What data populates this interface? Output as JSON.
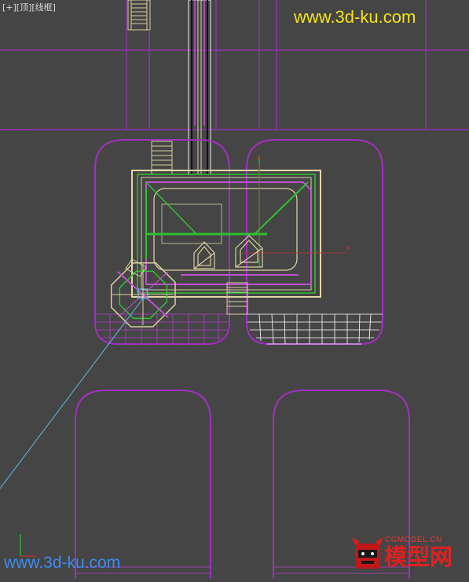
{
  "viewport": {
    "label": "[+][顶][线框]",
    "axis_x": "x",
    "axis_y": "y"
  },
  "watermarks": {
    "top": "www.3d-ku.com",
    "bottom": "www.3d-ku.com",
    "logo_small": "CGMODEL.CN",
    "logo_big": "模型网"
  },
  "colors": {
    "background": "#454545",
    "grid_magenta": "#a030c0",
    "object_tan": "#d8d0a0",
    "object_green": "#30c030",
    "mesh_white": "#ffffff",
    "selection_cyan": "#60b8e0",
    "watermark_yellow": "#f2e21a",
    "watermark_blue": "#3d8cf0"
  }
}
